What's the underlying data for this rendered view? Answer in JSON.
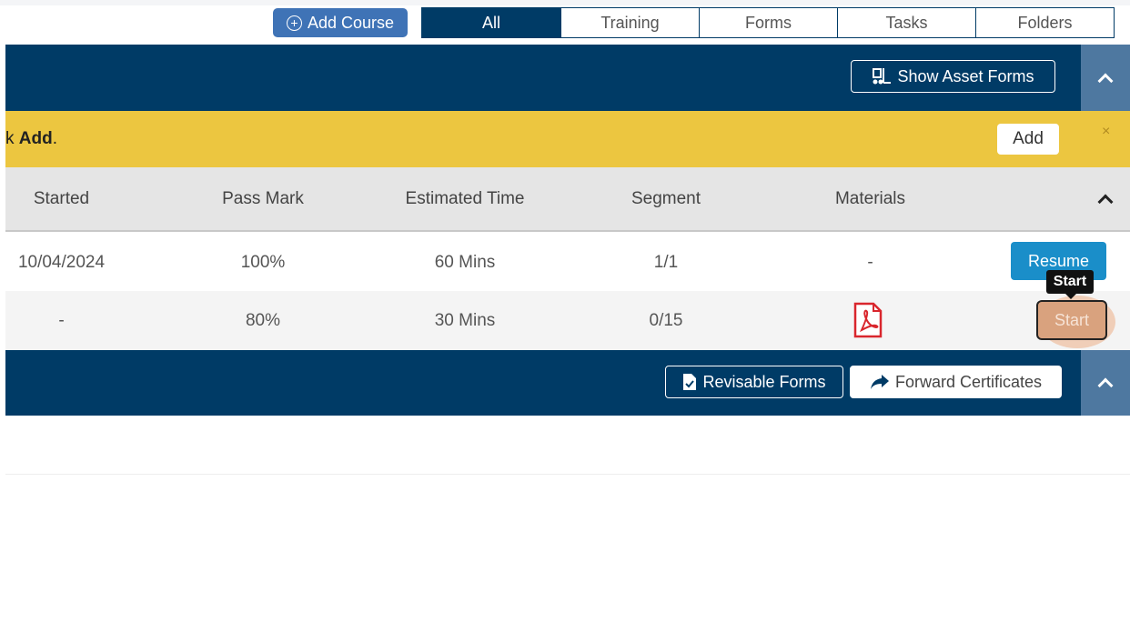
{
  "toolbar": {
    "add_course_label": "Add Course",
    "tabs": [
      {
        "label": "All",
        "active": true
      },
      {
        "label": "Training"
      },
      {
        "label": "Forms"
      },
      {
        "label": "Tasks"
      },
      {
        "label": "Folders"
      }
    ]
  },
  "section1": {
    "show_asset_forms_label": "Show Asset Forms"
  },
  "notice": {
    "text_prefix": "k ",
    "text_bold": "Add",
    "text_suffix": ".",
    "add_label": "Add",
    "close_symbol": "×"
  },
  "table": {
    "headers": [
      "Started",
      "Pass Mark",
      "Estimated Time",
      "Segment",
      "Materials"
    ],
    "rows": [
      {
        "started": "10/04/2024",
        "pass_mark": "100%",
        "estimated_time": "60 Mins",
        "segment": "1/1",
        "materials": "-",
        "action": "Resume"
      },
      {
        "started": "-",
        "pass_mark": "80%",
        "estimated_time": "30 Mins",
        "segment": "0/15",
        "materials_icon": "pdf-icon",
        "action": "Start"
      }
    ],
    "tooltip": "Start"
  },
  "section2": {
    "revisable_forms_label": "Revisable Forms",
    "forward_certificates_label": "Forward Certificates"
  },
  "colors": {
    "navy": "#003b66",
    "accent_blue": "#3f73b6",
    "notice_yellow": "#ecc640",
    "resume_blue": "#1a8ec9",
    "start_highlight": "#d9a27e",
    "pdf_red": "#d9262d"
  }
}
